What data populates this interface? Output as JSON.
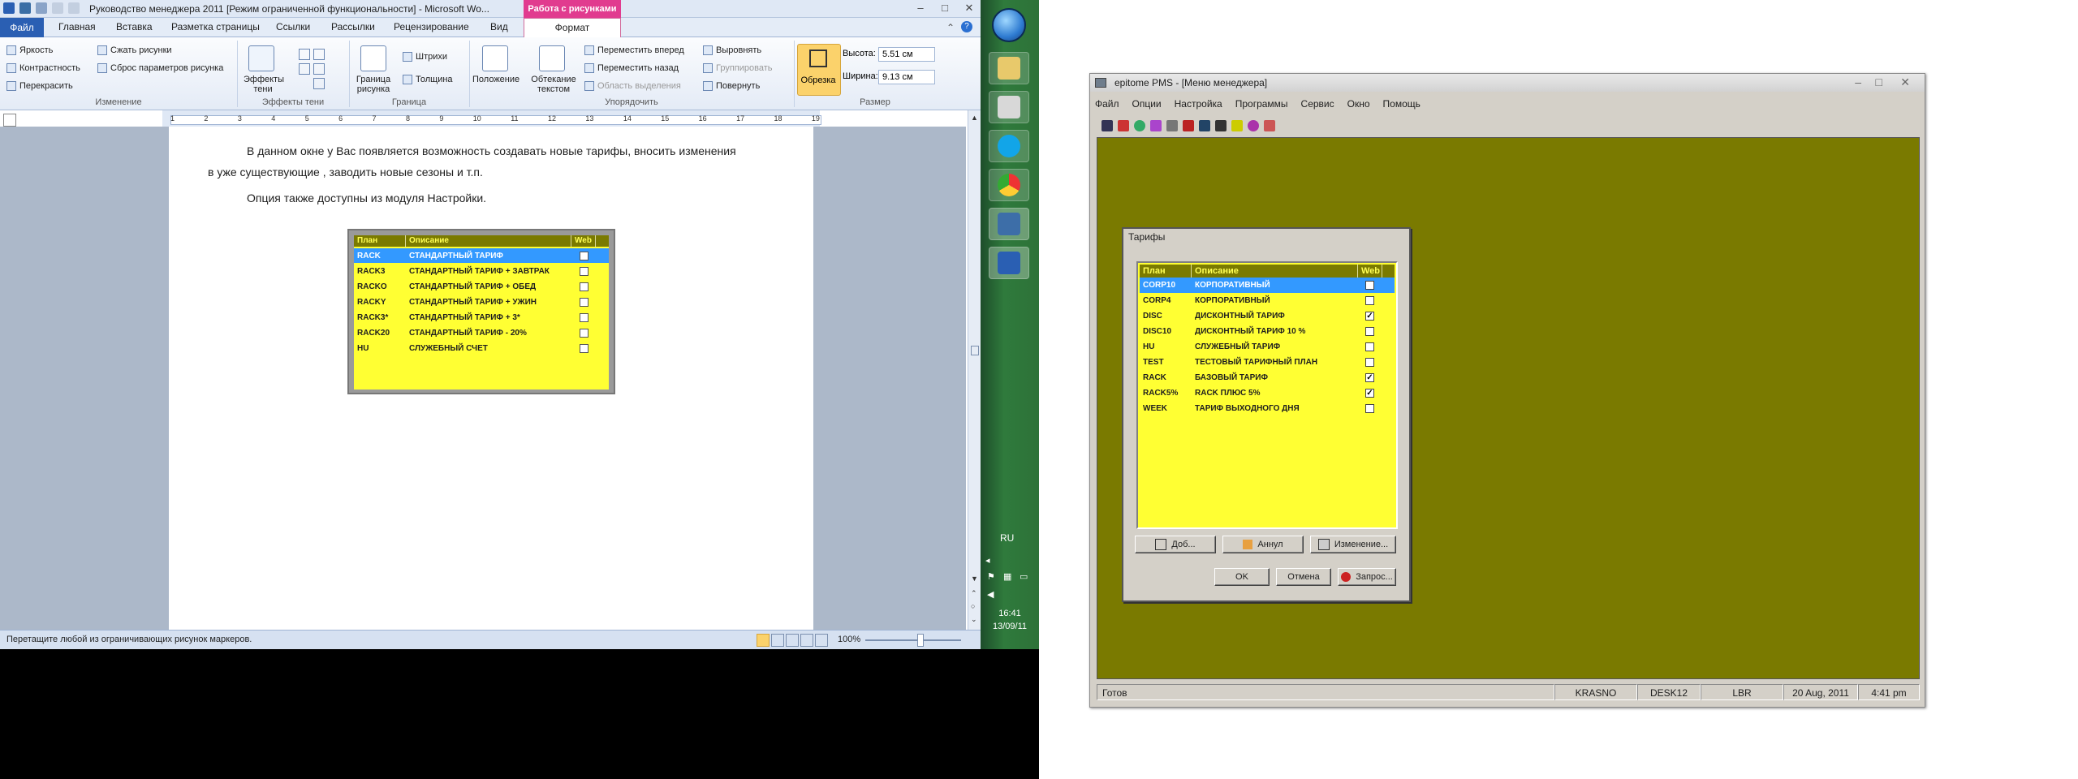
{
  "word": {
    "title": "Руководство менеджера 2011 [Режим ограниченной функциональности] - Microsoft Wo...",
    "context_tab": "Работа с рисунками",
    "tabs": [
      "Файл",
      "Главная",
      "Вставка",
      "Разметка страницы",
      "Ссылки",
      "Рассылки",
      "Рецензирование",
      "Вид",
      "Формат"
    ],
    "ribbon": {
      "izmenenie": {
        "items": [
          "Яркость",
          "Контрастность",
          "Перекрасить",
          "Сжать рисунки",
          "Сброс параметров рисунка"
        ],
        "label": "Изменение"
      },
      "effekty_teni": {
        "button": "Эффекты тени",
        "label": "Эффекты тени"
      },
      "granica": {
        "button": "Граница рисунка",
        "shtrihi": "Штрихи",
        "tolshina": "Толщина",
        "label": "Граница"
      },
      "uporyadochit": {
        "polozhenie": "Положение",
        "obtekanie": "Обтекание текстом",
        "items": [
          "Переместить вперед",
          "Переместить назад",
          "Область выделения",
          "Выровнять",
          "Группировать",
          "Повернуть"
        ],
        "label": "Упорядочить"
      },
      "razmer": {
        "obrezka": "Обрезка",
        "height_label": "Высота:",
        "height": "5.51 см",
        "width_label": "Ширина:",
        "width": "9.13 см",
        "label": "Размер"
      }
    },
    "ruler": [
      "1",
      "2",
      "3",
      "4",
      "5",
      "6",
      "7",
      "8",
      "9",
      "10",
      "11",
      "12",
      "13",
      "14",
      "15",
      "16",
      "17",
      "18",
      "19"
    ],
    "doc": {
      "line1": "В данном окне у Вас появляется  возможность создавать новые тарифы, вносить изменения",
      "line2": "в уже существующие , заводить новые сезоны и т.п.",
      "line3": "Опция также доступны из модуля Настройки."
    },
    "picture_table": {
      "headers": [
        "План",
        "Описание",
        "Web"
      ],
      "rows": [
        {
          "plan": "RACK",
          "desc": "СТАНДАРТНЫЙ ТАРИФ"
        },
        {
          "plan": "RACK3",
          "desc": "СТАНДАРТНЫЙ ТАРИФ + ЗАВТРАК"
        },
        {
          "plan": "RACKO",
          "desc": "СТАНДАРТНЫЙ ТАРИФ + ОБЕД"
        },
        {
          "plan": "RACKY",
          "desc": "СТАНДАРТНЫЙ ТАРИФ + УЖИН"
        },
        {
          "plan": "RACK3*",
          "desc": "СТАНДАРТНЫЙ ТАРИФ + 3*"
        },
        {
          "plan": "RACK20",
          "desc": "СТАНДАРТНЫЙ ТАРИФ - 20%"
        },
        {
          "plan": "HU",
          "desc": "СЛУЖЕБНЫЙ СЧЕТ"
        }
      ]
    },
    "status": "Перетащите любой из ограничивающих рисунок маркеров.",
    "zoom": "100%"
  },
  "taskbar": {
    "lang": "RU",
    "time": "16:41",
    "date": "13/09/11"
  },
  "pms": {
    "title": "epitome PMS - [Меню менеджера]",
    "menu": [
      "Файл",
      "Опции",
      "Настройка",
      "Программы",
      "Сервис",
      "Окно",
      "Помощь"
    ],
    "status": {
      "ready": "Готов",
      "user": "KRASNO",
      "desk": "DESK12",
      "lang": "LBR",
      "date": "20 Aug, 2011",
      "time": "4:41 pm"
    },
    "dialog": {
      "title": "Тарифы",
      "headers": [
        "План",
        "Описание",
        "Web"
      ],
      "rows": [
        {
          "plan": "CORP10",
          "desc": "КОРПОРАТИВНЫЙ",
          "web": false
        },
        {
          "plan": "CORP4",
          "desc": "КОРПОРАТИВНЫЙ",
          "web": false
        },
        {
          "plan": "DISC",
          "desc": "ДИСКОНТНЫЙ ТАРИФ",
          "web": true
        },
        {
          "plan": "DISC10",
          "desc": "ДИСКОНТНЫЙ ТАРИФ 10 %",
          "web": false
        },
        {
          "plan": "HU",
          "desc": "СЛУЖЕБНЫЙ ТАРИФ",
          "web": false
        },
        {
          "plan": "TEST",
          "desc": "ТЕСТОВЫЙ ТАРИФНЫЙ ПЛАН",
          "web": false
        },
        {
          "plan": "RACK",
          "desc": "БАЗОВЫЙ ТАРИФ",
          "web": true
        },
        {
          "plan": "RACK5%",
          "desc": "RACK ПЛЮС 5%",
          "web": true
        },
        {
          "plan": "WEEK",
          "desc": "ТАРИФ ВЫХОДНОГО ДНЯ",
          "web": false
        }
      ],
      "buttons": {
        "add": "Доб...",
        "cancel_rate": "Аннул",
        "change": "Изменение...",
        "ok": "OK",
        "cancel": "Отмена",
        "request": "Запрос..."
      }
    }
  }
}
